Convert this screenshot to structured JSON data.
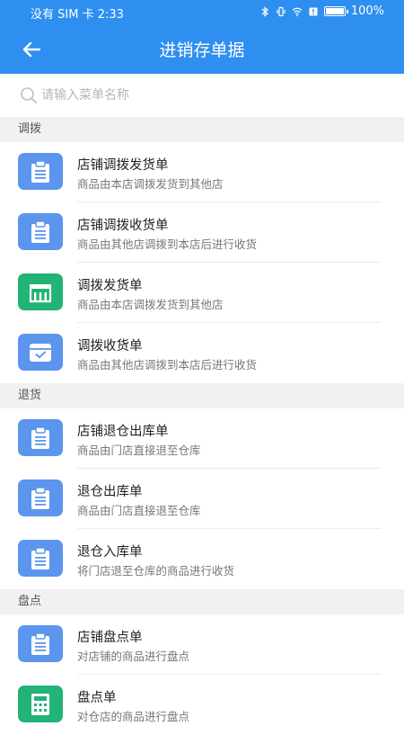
{
  "status_bar": {
    "carrier_time": "没有 SIM 卡 2:33",
    "battery_percent": "100%"
  },
  "header": {
    "title": "进销存单据"
  },
  "search": {
    "placeholder": "请输入菜单名称"
  },
  "sections": [
    {
      "label": "调拨",
      "items": [
        {
          "title": "店铺调拨发货单",
          "desc": "商品由本店调拨发货到其他店",
          "icon": "clipboard-icon",
          "color": "blue"
        },
        {
          "title": "店铺调拨收货单",
          "desc": "商品由其他店调拨到本店后进行收货",
          "icon": "clipboard-icon",
          "color": "blue"
        },
        {
          "title": "调拨发货单",
          "desc": "商品由本店调拨发货到其他店",
          "icon": "store-icon",
          "color": "green"
        },
        {
          "title": "调拨收货单",
          "desc": "商品由其他店调拨到本店后进行收货",
          "icon": "inbox-check-icon",
          "color": "blue"
        }
      ]
    },
    {
      "label": "退货",
      "items": [
        {
          "title": "店铺退仓出库单",
          "desc": "商品由门店直接退至仓库",
          "icon": "clipboard-icon",
          "color": "blue"
        },
        {
          "title": "退仓出库单",
          "desc": "商品由门店直接退至仓库",
          "icon": "clipboard-icon",
          "color": "blue"
        },
        {
          "title": "退仓入库单",
          "desc": "将门店退至仓库的商品进行收货",
          "icon": "clipboard-icon",
          "color": "blue"
        }
      ]
    },
    {
      "label": "盘点",
      "items": [
        {
          "title": "店铺盘点单",
          "desc": "对店铺的商品进行盘点",
          "icon": "clipboard-icon",
          "color": "blue"
        },
        {
          "title": "盘点单",
          "desc": "对仓店的商品进行盘点",
          "icon": "calculator-icon",
          "color": "green"
        }
      ]
    }
  ],
  "colors": {
    "header": "#2f8ff0",
    "icon_blue": "#5b95ee",
    "icon_green": "#22b377",
    "section_bg": "#f1f1f1"
  }
}
